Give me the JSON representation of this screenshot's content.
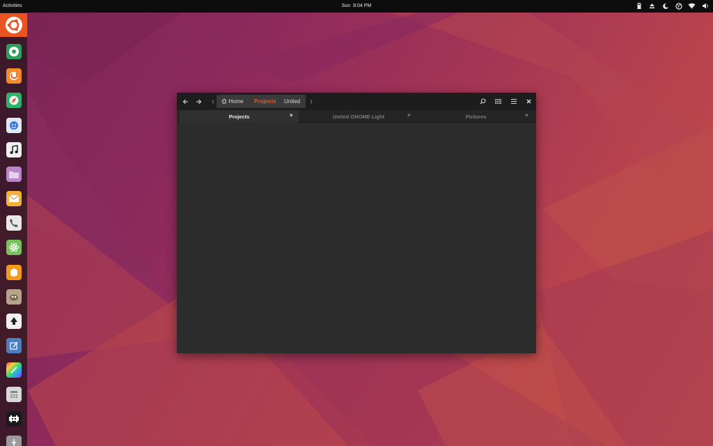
{
  "topbar": {
    "activities": "Activities",
    "day": "Sun",
    "time": "8:04 PM"
  },
  "tray_icons": [
    "battery-icon",
    "eject-icon",
    "night-light-icon",
    "network-globe-icon",
    "wifi-icon",
    "volume-icon"
  ],
  "dock": {
    "apps": [
      "ubuntu",
      "chrome",
      "firefox",
      "safari",
      "finder",
      "music",
      "files",
      "mail",
      "phone",
      "atom",
      "package",
      "gimp",
      "inkscape",
      "editor",
      "color-picker",
      "calculator",
      "space-invaders",
      "usb"
    ]
  },
  "window": {
    "path": {
      "home": "Home",
      "projects": "Projects",
      "united": "United"
    },
    "tabs": [
      {
        "label": "Projects"
      },
      {
        "label": "United GNOME Light"
      },
      {
        "label": "Pictures"
      }
    ],
    "close_glyph": "×"
  },
  "colors": {
    "accent": "#e95420",
    "topbar_bg": "#0d0d0d",
    "window_bg": "#2c2c2c",
    "headerbar_bg": "#1d1d1d"
  }
}
